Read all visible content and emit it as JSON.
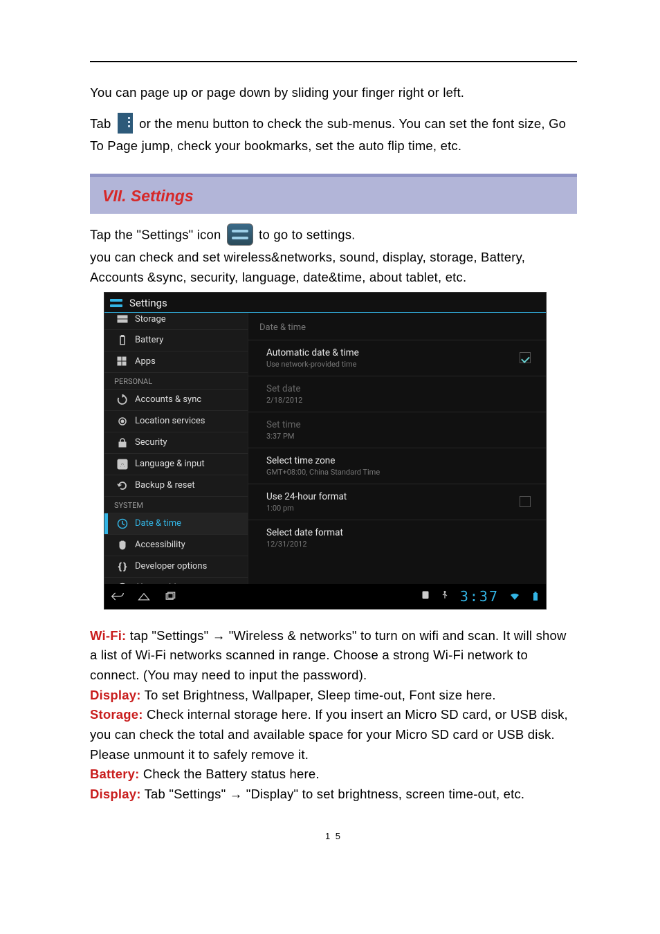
{
  "doc": {
    "p1": "You can page up or page down by sliding your finger right or left.",
    "p2a": "Tab",
    "p2b": "or the menu button to check the sub-menus. You can set the font size, Go To Page jump, check your bookmarks, set the auto flip time, etc.",
    "section_title": "VII. Settings",
    "p3a": "Tap the \"Settings\" icon",
    "p3b": "to go to settings.",
    "p4": "you can check and set wireless&networks, sound, display, storage, Battery, Accounts &sync, security, language, date&time, about tablet, etc.",
    "t_wifi": "Wi-Fi:",
    "d_wifi": "  tap \"Settings\" →   \"Wireless & networks\" to turn on wifi and scan. It will show a list of Wi-Fi networks scanned in range.   Choose a strong Wi-Fi network to connect. (You may need to input the password).",
    "t_display": "Display:",
    "d_display": " To set Brightness, Wallpaper, Sleep time-out,   Font size here.",
    "t_storage": "Storage:",
    "d_storage": " Check internal storage here. If you insert an Micro SD card, or USB disk, you can check the total and available space for your Micro SD card or USB disk.   Please unmount it to safely remove it.",
    "t_battery": "Battery:",
    "d_battery": " Check the Battery status here.",
    "t_display2": "Display:",
    "d_display2": " Tab \"Settings\" →   \"Display\" to set brightness, screen time-out, etc.",
    "page_number": "1 5"
  },
  "shot": {
    "topbar_label": "Settings",
    "sidebar": {
      "items": [
        {
          "label": "Storage",
          "icon": "storage"
        },
        {
          "label": "Battery",
          "icon": "battery"
        },
        {
          "label": "Apps",
          "icon": "apps"
        }
      ],
      "cat1": "PERSONAL",
      "items2": [
        {
          "label": "Accounts & sync",
          "icon": "sync"
        },
        {
          "label": "Location services",
          "icon": "target"
        },
        {
          "label": "Security",
          "icon": "lock"
        },
        {
          "label": "Language & input",
          "icon": "lang"
        },
        {
          "label": "Backup & reset",
          "icon": "backup"
        }
      ],
      "cat2": "SYSTEM",
      "items3": [
        {
          "label": "Date & time",
          "icon": "clock",
          "selected": true
        },
        {
          "label": "Accessibility",
          "icon": "hand"
        },
        {
          "label": "Developer options",
          "icon": "braces"
        },
        {
          "label": "About tablet",
          "icon": "info"
        }
      ]
    },
    "detail": {
      "header": "Date & time",
      "rows": [
        {
          "title": "Automatic date & time",
          "sub": "Use network-provided time",
          "checkbox": true,
          "checked": true
        },
        {
          "title": "Set date",
          "sub": "2/18/2012",
          "disabled": true
        },
        {
          "title": "Set time",
          "sub": "3:37 PM",
          "disabled": true
        },
        {
          "title": "Select time zone",
          "sub": "GMT+08:00, China Standard Time"
        },
        {
          "title": "Use 24-hour format",
          "sub": "1:00 pm",
          "checkbox": true,
          "checked": false
        },
        {
          "title": "Select date format",
          "sub": "12/31/2012"
        }
      ]
    },
    "clock": "3:37"
  }
}
